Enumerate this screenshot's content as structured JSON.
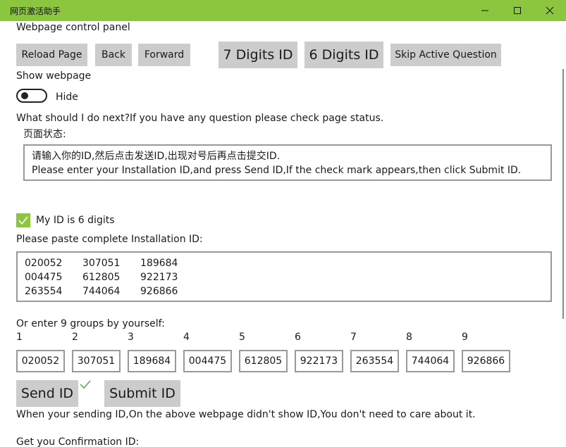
{
  "window": {
    "title": "网页激活助手"
  },
  "control_panel": {
    "heading": "Webpage control panel",
    "reload_label": "Reload Page",
    "back_label": "Back",
    "forward_label": "Forward",
    "seven_digits_label": "7 Digits ID",
    "six_digits_label": "6 Digits ID",
    "skip_label": "Skip Active Question"
  },
  "webpage_toggle": {
    "heading": "Show webpage",
    "state_label": "Hide"
  },
  "status": {
    "prompt": "What should I do next?If you have any question please check page status.",
    "heading": "页面状态:",
    "line1": "请输入你的ID,然后点击发送ID,出现对号后再点击提交ID.",
    "line2": "Please enter your Installation ID,and press Send ID,If the check mark appears,then click Submit ID."
  },
  "six_digit_option": {
    "label": "My ID is 6 digits",
    "checked": true
  },
  "installation_id": {
    "label": "Please paste complete Installation ID:",
    "rows": [
      [
        "020052",
        "307051",
        "189684"
      ],
      [
        "004475",
        "612805",
        "922173"
      ],
      [
        "263554",
        "744064",
        "926866"
      ]
    ]
  },
  "groups": {
    "label": "Or enter 9 groups by yourself:",
    "numbers": [
      "1",
      "2",
      "3",
      "4",
      "5",
      "6",
      "7",
      "8",
      "9"
    ],
    "values": [
      "020052",
      "307051",
      "189684",
      "004475",
      "612805",
      "922173",
      "263554",
      "744064",
      "926866"
    ]
  },
  "actions": {
    "send_label": "Send ID",
    "submit_label": "Submit ID",
    "note": "When your sending ID,On the above webpage didn't show ID,You don't need to care about it.",
    "confirmation_label": "Get you Confirmation ID:"
  },
  "colors": {
    "accent": "#8cc63f",
    "button": "#cccccc",
    "border": "#999999"
  }
}
